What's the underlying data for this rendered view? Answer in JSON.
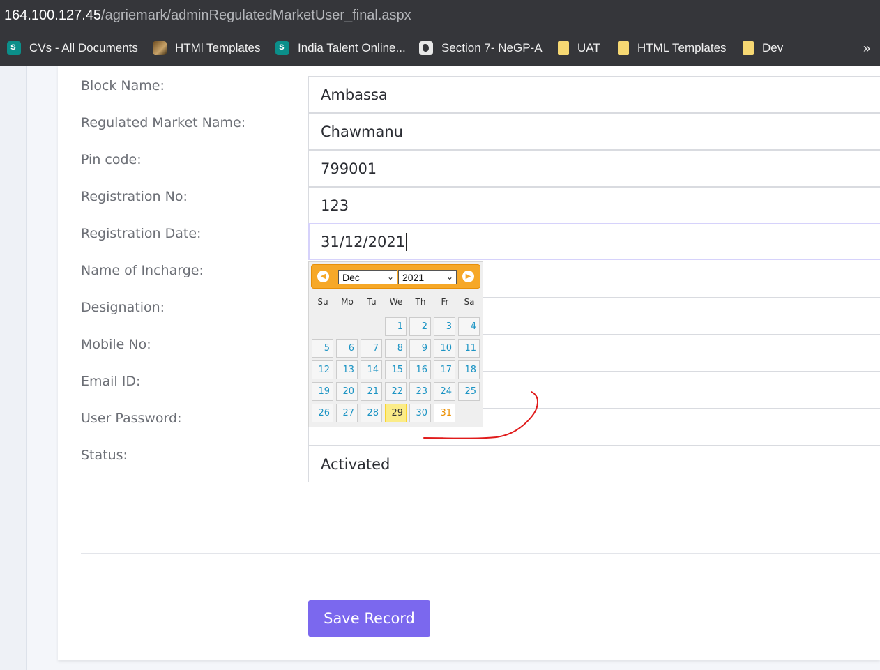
{
  "browser": {
    "url_host": "164.100.127.45",
    "url_path": "/agriemark/adminRegulatedMarketUser_final.aspx",
    "bookmarks": [
      {
        "label": "CVs - All Documents",
        "icon": "sharepoint-icon"
      },
      {
        "label": "HTMl Templates",
        "icon": "image-icon"
      },
      {
        "label": "India Talent Online...",
        "icon": "sharepoint-icon"
      },
      {
        "label": "Section 7- NeGP-A",
        "icon": "globe-icon"
      },
      {
        "label": "UAT",
        "icon": "folder-icon"
      },
      {
        "label": "HTML Templates",
        "icon": "folder-icon"
      },
      {
        "label": "Dev",
        "icon": "folder-icon"
      }
    ],
    "more": "»"
  },
  "form": {
    "fields": [
      {
        "label": "Block Name:",
        "value": "Ambassa"
      },
      {
        "label": "Regulated Market Name:",
        "value": "Chawmanu"
      },
      {
        "label": "Pin code:",
        "value": "799001"
      },
      {
        "label": "Registration No:",
        "value": "123"
      },
      {
        "label": "Registration Date:",
        "value": "31/12/2021"
      },
      {
        "label": "Name of Incharge:",
        "value": ""
      },
      {
        "label": "Designation:",
        "value": ""
      },
      {
        "label": "Mobile No:",
        "value": ""
      },
      {
        "label": "Email ID:",
        "value": ""
      },
      {
        "label": "User Password:",
        "value": ""
      },
      {
        "label": "Status:",
        "value": "Activated"
      }
    ],
    "save_label": "Save Record"
  },
  "datepicker": {
    "month": "Dec",
    "year": "2021",
    "weekdays": [
      "Su",
      "Mo",
      "Tu",
      "We",
      "Th",
      "Fr",
      "Sa"
    ],
    "days": [
      "1",
      "2",
      "3",
      "4",
      "5",
      "6",
      "7",
      "8",
      "9",
      "10",
      "11",
      "12",
      "13",
      "14",
      "15",
      "16",
      "17",
      "18",
      "19",
      "20",
      "21",
      "22",
      "23",
      "24",
      "25",
      "26",
      "27",
      "28",
      "29",
      "30",
      "31"
    ],
    "first_weekday_index": 3,
    "today": "29",
    "selected": "31"
  },
  "colors": {
    "accent": "#7b68ee",
    "datepicker_header": "#f6a828",
    "day_text": "#1c94c4",
    "annotation_stroke": "#e01b1b"
  }
}
